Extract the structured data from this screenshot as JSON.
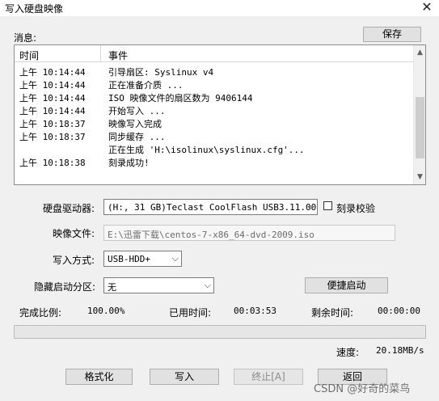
{
  "window": {
    "title": "写入硬盘映像",
    "close_glyph": "✕"
  },
  "messages": {
    "label": "消息:",
    "save_button": "保存",
    "columns": {
      "time": "时间",
      "event": "事件"
    },
    "rows": [
      {
        "time": "上午 10:14:44",
        "event": "引导扇区: Syslinux v4"
      },
      {
        "time": "上午 10:14:44",
        "event": "正在准备介质 ..."
      },
      {
        "time": "上午 10:14:44",
        "event": "ISO 映像文件的扇区数为 9406144"
      },
      {
        "time": "上午 10:14:44",
        "event": "开始写入 ..."
      },
      {
        "time": "上午 10:18:37",
        "event": "映像写入完成"
      },
      {
        "time": "上午 10:18:37",
        "event": "同步缓存 ..."
      },
      {
        "time": "",
        "event": "正在生成 'H:\\isolinux\\syslinux.cfg'..."
      },
      {
        "time": "上午 10:18:38",
        "event": "刻录成功!"
      }
    ]
  },
  "form": {
    "drive_label": "硬盘驱动器:",
    "drive_value": "(H:, 31 GB)Teclast CoolFlash USB3.11.00",
    "verify_label": "刻录校验",
    "image_label": "映像文件:",
    "image_value": "E:\\迅雷下载\\centos-7-x86_64-dvd-2009.iso",
    "write_mode_label": "写入方式:",
    "write_mode_value": "USB-HDD+",
    "hidden_partition_label": "隐藏启动分区:",
    "hidden_partition_value": "无",
    "quick_boot_button": "便捷启动"
  },
  "status": {
    "ratio_label": "完成比例:",
    "ratio_value": "100.00%",
    "elapsed_label": "已用时间:",
    "elapsed_value": "00:03:53",
    "remaining_label": "剩余时间:",
    "remaining_value": "00:00:00",
    "progress_percent": 100,
    "speed_label": "速度:",
    "speed_value": "20.18MB/s"
  },
  "buttons": {
    "format": "格式化",
    "write": "写入",
    "stop": "终止[A]",
    "back": "返回"
  },
  "watermark": "CSDN @好奇的菜鸟",
  "icons": {
    "dropdown": "chevron-down-icon",
    "close": "close-icon"
  }
}
